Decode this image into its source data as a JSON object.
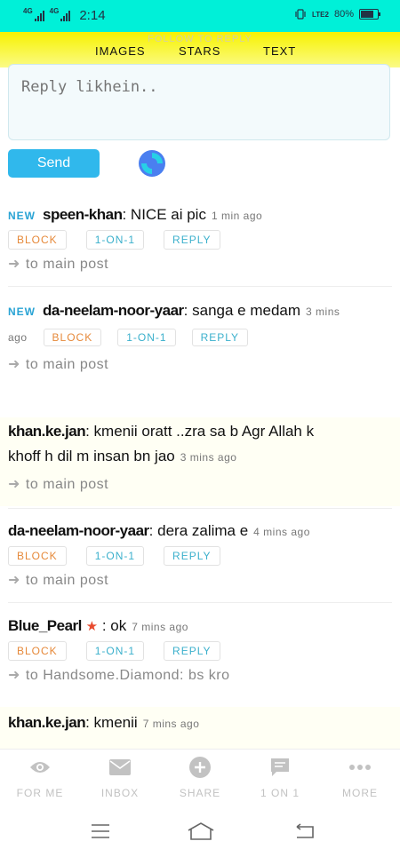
{
  "status": {
    "net1": "4G",
    "net2": "4G",
    "time": "2:14",
    "volte": "LTE2",
    "battery": "80%"
  },
  "header": {
    "follow": "FOLLOW TO REPLY",
    "tabs": [
      "IMAGES",
      "STARS",
      "TEXT"
    ]
  },
  "reply": {
    "placeholder": "Reply likhein..",
    "send_label": "Send"
  },
  "labels": {
    "new": "NEW",
    "block": "BLOCK",
    "one_on_one": "1-ON-1",
    "reply": "REPLY",
    "arrow": "➜"
  },
  "posts": [
    {
      "user": "speen-khan",
      "text": ": NICE ai pic",
      "ago": "1 min ago",
      "target": "to main post"
    },
    {
      "user": "da-neelam-noor-yaar",
      "text": ": sanga e medam",
      "ago_a": "3 mins",
      "ago_b": "ago",
      "target": "to main post"
    },
    {
      "user": "khan.ke.jan",
      "text_a": ": kmenii oratt ..zra sa b Agr Allah k",
      "text_b": "khoff h dil m insan bn jao",
      "ago": "3 mins ago",
      "target": "to main post"
    },
    {
      "user": "da-neelam-noor-yaar",
      "text": ": dera zalima e",
      "ago": "4 mins ago",
      "target": "to main post"
    },
    {
      "user": "Blue_Pearl",
      "text": ": ok",
      "ago": "7 mins ago",
      "target": "to Handsome.Diamond: bs kro"
    },
    {
      "user": "khan.ke.jan",
      "text": ": kmenii",
      "ago": "7 mins ago"
    }
  ],
  "nav": [
    "FOR ME",
    "INBOX",
    "SHARE",
    "1 ON 1",
    "MORE"
  ],
  "colors": {
    "status_bg": "#00f0d8",
    "header_bg": "#f7f200",
    "accent": "#30b8ec",
    "block": "#e6893a",
    "star": "#e84a2e"
  }
}
